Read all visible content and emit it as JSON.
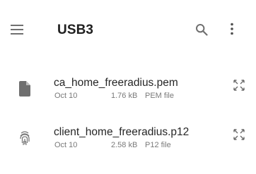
{
  "header": {
    "title": "USB3",
    "menu_icon": "hamburger-menu-icon",
    "search_icon": "search-icon",
    "more_icon": "more-vertical-icon"
  },
  "files": [
    {
      "name": "ca_home_freeradius.pem",
      "date": "Oct 10",
      "size": "1.76 kB",
      "type": "PEM file",
      "icon": "document-icon"
    },
    {
      "name": "client_home_freeradius.p12",
      "date": "Oct 10",
      "size": "2.58 kB",
      "type": "P12 file",
      "icon": "fingerprint-icon"
    }
  ],
  "colors": {
    "icon": "#6f6f6f",
    "text": "#262626",
    "meta": "#7a7a7a"
  }
}
